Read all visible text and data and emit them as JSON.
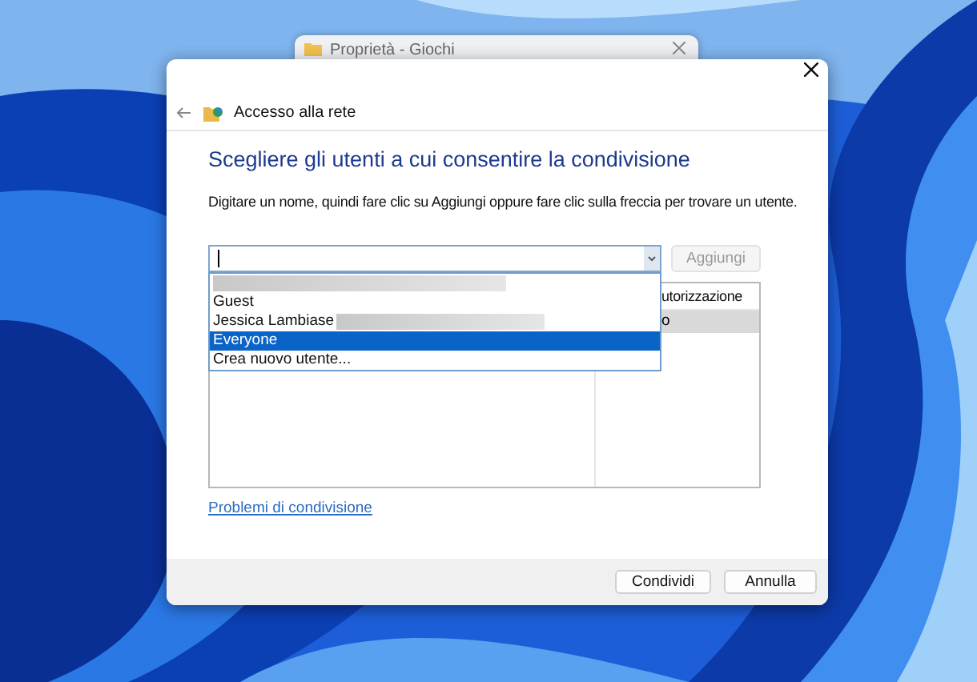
{
  "background_window": {
    "title": "Proprietà - Giochi"
  },
  "dialog": {
    "nav_title": "Accesso alla rete",
    "heading": "Scegliere gli utenti a cui consentire la condivisione",
    "instructions": "Digitare un nome, quindi fare clic su Aggiungi oppure fare clic sulla freccia per trovare un utente.",
    "add_button": {
      "label": "Aggiungi",
      "disabled": true
    },
    "dropdown": {
      "items": [
        {
          "kind": "redacted",
          "selected": false
        },
        {
          "kind": "user",
          "label": "Guest",
          "redacted": false,
          "selected": false
        },
        {
          "kind": "user",
          "label": "Jessica Lambiase",
          "redacted": true,
          "selected": false
        },
        {
          "kind": "user",
          "label": "Everyone",
          "redacted": false,
          "selected": true
        },
        {
          "kind": "user",
          "label": "Crea nuovo utente...",
          "redacted": false,
          "selected": false
        }
      ]
    },
    "table": {
      "columns": [
        "utorizzazione"
      ],
      "rows": [
        {
          "cells": [
            "o"
          ],
          "selected": true
        }
      ]
    },
    "link": "Problemi di condivisione",
    "buttons": [
      "Condividi",
      "Annulla"
    ]
  }
}
